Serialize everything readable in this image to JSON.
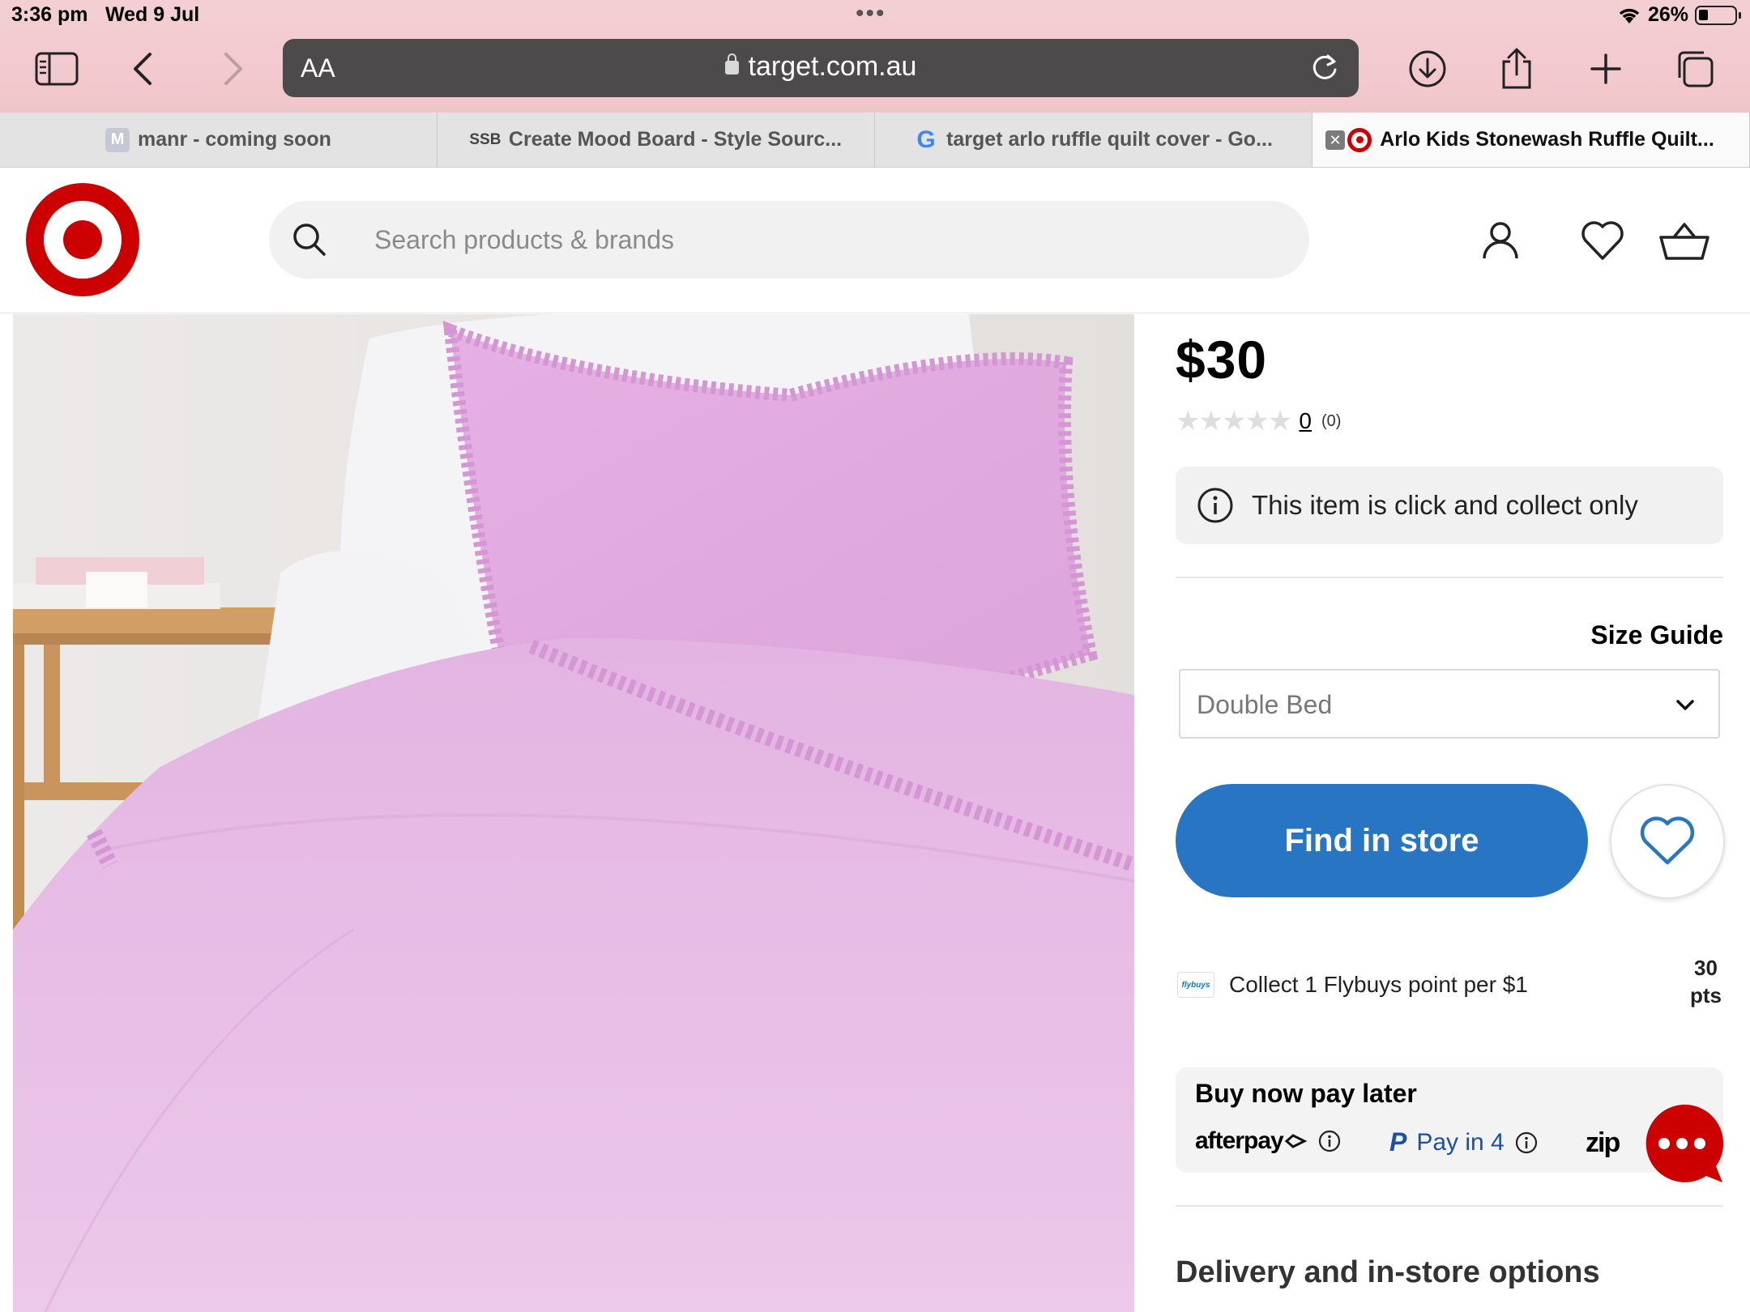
{
  "status": {
    "time": "3:36 pm",
    "date": "Wed 9 Jul",
    "battery": "26%"
  },
  "browser": {
    "text_size_label": "AA",
    "domain": "target.com.au",
    "tabs": [
      {
        "label": "manr - coming soon",
        "favicon": "M"
      },
      {
        "label": "Create Mood Board - Style Sourc...",
        "favicon": "SSB"
      },
      {
        "label": "target arlo ruffle quilt cover - Go...",
        "favicon": "G"
      },
      {
        "label": "Arlo Kids Stonewash Ruffle Quilt...",
        "favicon": "target"
      }
    ]
  },
  "header": {
    "search_placeholder": "Search products & brands"
  },
  "product": {
    "price": "$30",
    "stars": "★★★★★",
    "rating_count": "0",
    "rating_total": "(0)",
    "notice": "This item is click and collect only",
    "size_guide": "Size Guide",
    "size_selected": "Double Bed",
    "find_in_store": "Find in store",
    "flybuys_logo": "flybuys",
    "flybuys_text": "Collect 1 Flybuys point per $1",
    "flybuys_points": "30",
    "flybuys_unit": "pts",
    "bnpl_title": "Buy now pay later",
    "afterpay": "afterpay",
    "paypal": "Pay in 4",
    "zip": "zip",
    "delivery_heading": "Delivery and in-store options"
  },
  "colors": {
    "brand_red": "#cc0000",
    "button_blue": "#2876c3",
    "url_bar": "#4c4a4a"
  }
}
